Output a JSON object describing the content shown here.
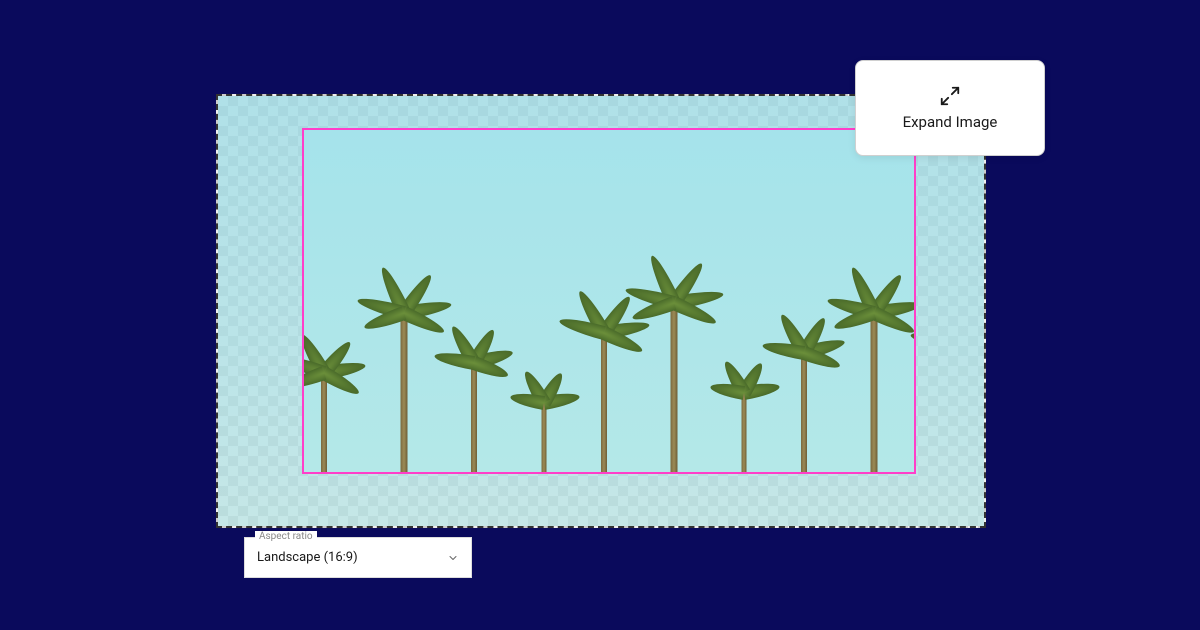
{
  "expand_button": {
    "label": "Expand Image",
    "icon": "expand-arrows-icon"
  },
  "aspect_ratio": {
    "legend": "Aspect ratio",
    "selected": "Landscape (16:9)"
  },
  "crop": {
    "selection_color": "#ff3ec9"
  },
  "colors": {
    "background": "#0a0a5c",
    "card_bg": "#ffffff"
  }
}
